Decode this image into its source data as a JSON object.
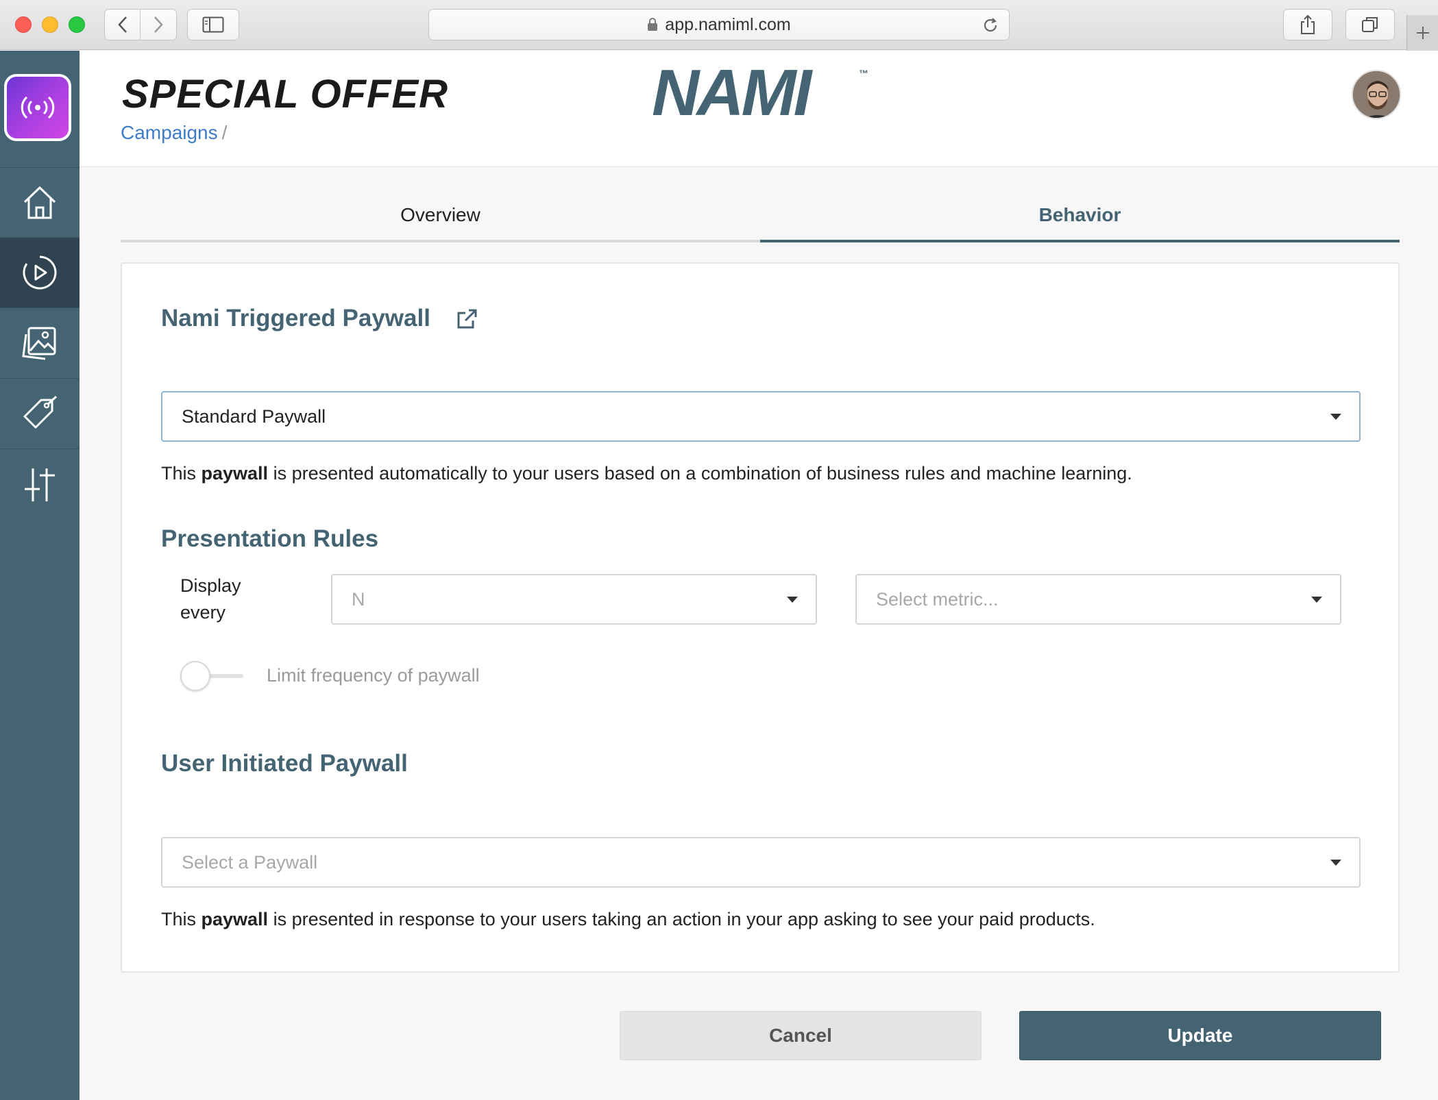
{
  "browser": {
    "url": "app.namiml.com"
  },
  "header": {
    "title": "SPECIAL OFFER",
    "breadcrumb": "Campaigns",
    "breadcrumb_sep": "/",
    "brand": "NAMI",
    "brand_tm": "™"
  },
  "sidebar": {
    "items": [
      {
        "name": "home",
        "icon": "home-icon",
        "active": false
      },
      {
        "name": "campaigns",
        "icon": "play-circle-icon",
        "active": true
      },
      {
        "name": "paywalls",
        "icon": "images-icon",
        "active": false
      },
      {
        "name": "products",
        "icon": "tag-icon",
        "active": false
      },
      {
        "name": "settings",
        "icon": "sliders-icon",
        "active": false
      }
    ]
  },
  "tabs": [
    {
      "label": "Overview",
      "active": false
    },
    {
      "label": "Behavior",
      "active": true
    }
  ],
  "triggered": {
    "title": "Nami Triggered Paywall",
    "selected": "Standard Paywall",
    "desc_prefix": "This ",
    "desc_bold": "paywall",
    "desc_suffix": " is presented automatically to your users based on a combination of business rules and machine learning."
  },
  "rules": {
    "title": "Presentation Rules",
    "display_label_1": "Display",
    "display_label_2": "every",
    "n_placeholder": "N",
    "metric_placeholder": "Select metric...",
    "limit_label": "Limit frequency of paywall",
    "limit_enabled": false
  },
  "user_initiated": {
    "title": "User Initiated Paywall",
    "placeholder": "Select a Paywall",
    "desc_prefix": "This ",
    "desc_bold": "paywall",
    "desc_suffix": " is presented in response to your users taking an action in your app asking to see your paid products."
  },
  "actions": {
    "cancel": "Cancel",
    "update": "Update"
  },
  "colors": {
    "primary": "#456473",
    "link": "#3d7cc9",
    "app_icon_gradient": "#6c35d6"
  }
}
